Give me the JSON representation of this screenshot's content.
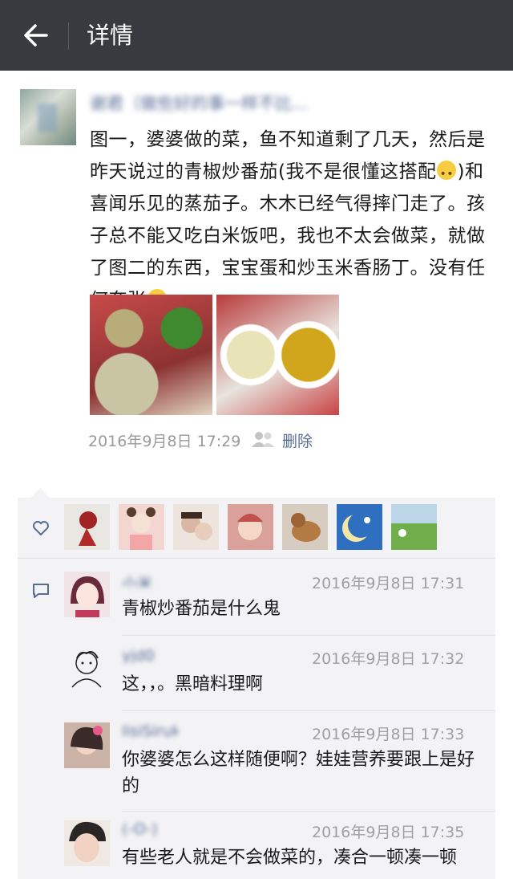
{
  "header": {
    "title": "详情"
  },
  "post": {
    "author": "谢君（做些好的事一样不比...",
    "text_parts": [
      "图一，婆婆做的菜，鱼不知道剩了几天，然后是昨天说过的青椒炒番茄(我不是很懂这搭配",
      ")和喜闻乐见的蒸茄子。木木已经气得摔门走了。孩子总不能又吃白米饭吧，我也不太会做菜，就做了图二的东西，宝宝蛋和炒玉米香肠丁。没有任何夸张"
    ],
    "timestamp": "2016年9月8日 17:29",
    "delete_label": "删除"
  },
  "likes": {
    "icon": "heart-icon",
    "count": 7
  },
  "comments": [
    {
      "name": "小米",
      "time": "2016年9月8日 17:31",
      "text": "青椒炒番茄是什么鬼"
    },
    {
      "name": "yjd0",
      "time": "2016年9月8日 17:32",
      "text": "这，，。黑暗料理啊"
    },
    {
      "name": "lisiSiruk",
      "time": "2016年9月8日 17:33",
      "text": "你婆婆怎么这样随便啊？娃娃营养要跟上是好的"
    },
    {
      "name": "(-O-)",
      "time": "2016年9月8日 17:35",
      "text": "有些老人就是不会做菜的，凑合一顿凑一顿"
    }
  ],
  "colors": {
    "topbar": "#393a3f",
    "link": "#576b95",
    "panel": "#f3f3f5"
  }
}
